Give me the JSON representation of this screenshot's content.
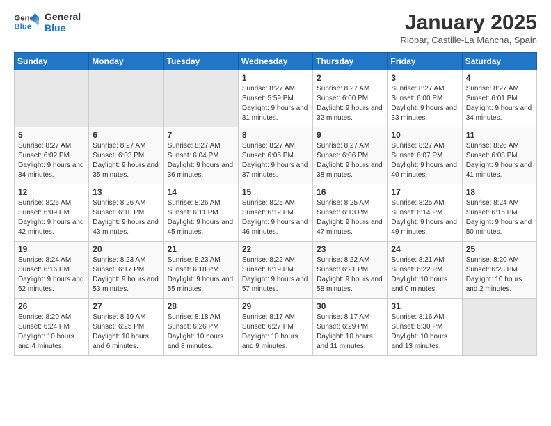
{
  "logo": {
    "line1": "General",
    "line2": "Blue"
  },
  "header": {
    "title": "January 2025",
    "location": "Riopar, Castille-La Mancha, Spain"
  },
  "weekdays": [
    "Sunday",
    "Monday",
    "Tuesday",
    "Wednesday",
    "Thursday",
    "Friday",
    "Saturday"
  ],
  "weeks": [
    [
      {
        "day": "",
        "empty": true
      },
      {
        "day": "",
        "empty": true
      },
      {
        "day": "",
        "empty": true
      },
      {
        "day": "1",
        "sunrise": "8:27 AM",
        "sunset": "5:59 PM",
        "daylight": "9 hours and 31 minutes."
      },
      {
        "day": "2",
        "sunrise": "8:27 AM",
        "sunset": "6:00 PM",
        "daylight": "9 hours and 32 minutes."
      },
      {
        "day": "3",
        "sunrise": "8:27 AM",
        "sunset": "6:00 PM",
        "daylight": "9 hours and 33 minutes."
      },
      {
        "day": "4",
        "sunrise": "8:27 AM",
        "sunset": "6:01 PM",
        "daylight": "9 hours and 34 minutes."
      }
    ],
    [
      {
        "day": "5",
        "sunrise": "8:27 AM",
        "sunset": "6:02 PM",
        "daylight": "9 hours and 34 minutes."
      },
      {
        "day": "6",
        "sunrise": "8:27 AM",
        "sunset": "6:03 PM",
        "daylight": "9 hours and 35 minutes."
      },
      {
        "day": "7",
        "sunrise": "8:27 AM",
        "sunset": "6:04 PM",
        "daylight": "9 hours and 36 minutes."
      },
      {
        "day": "8",
        "sunrise": "8:27 AM",
        "sunset": "6:05 PM",
        "daylight": "9 hours and 37 minutes."
      },
      {
        "day": "9",
        "sunrise": "8:27 AM",
        "sunset": "6:06 PM",
        "daylight": "9 hours and 38 minutes."
      },
      {
        "day": "10",
        "sunrise": "8:27 AM",
        "sunset": "6:07 PM",
        "daylight": "9 hours and 40 minutes."
      },
      {
        "day": "11",
        "sunrise": "8:26 AM",
        "sunset": "6:08 PM",
        "daylight": "9 hours and 41 minutes."
      }
    ],
    [
      {
        "day": "12",
        "sunrise": "8:26 AM",
        "sunset": "6:09 PM",
        "daylight": "9 hours and 42 minutes."
      },
      {
        "day": "13",
        "sunrise": "8:26 AM",
        "sunset": "6:10 PM",
        "daylight": "9 hours and 43 minutes."
      },
      {
        "day": "14",
        "sunrise": "8:26 AM",
        "sunset": "6:11 PM",
        "daylight": "9 hours and 45 minutes."
      },
      {
        "day": "15",
        "sunrise": "8:25 AM",
        "sunset": "6:12 PM",
        "daylight": "9 hours and 46 minutes."
      },
      {
        "day": "16",
        "sunrise": "8:25 AM",
        "sunset": "6:13 PM",
        "daylight": "9 hours and 47 minutes."
      },
      {
        "day": "17",
        "sunrise": "8:25 AM",
        "sunset": "6:14 PM",
        "daylight": "9 hours and 49 minutes."
      },
      {
        "day": "18",
        "sunrise": "8:24 AM",
        "sunset": "6:15 PM",
        "daylight": "9 hours and 50 minutes."
      }
    ],
    [
      {
        "day": "19",
        "sunrise": "8:24 AM",
        "sunset": "6:16 PM",
        "daylight": "9 hours and 52 minutes."
      },
      {
        "day": "20",
        "sunrise": "8:23 AM",
        "sunset": "6:17 PM",
        "daylight": "9 hours and 53 minutes."
      },
      {
        "day": "21",
        "sunrise": "8:23 AM",
        "sunset": "6:18 PM",
        "daylight": "9 hours and 55 minutes."
      },
      {
        "day": "22",
        "sunrise": "8:22 AM",
        "sunset": "6:19 PM",
        "daylight": "9 hours and 57 minutes."
      },
      {
        "day": "23",
        "sunrise": "8:22 AM",
        "sunset": "6:21 PM",
        "daylight": "9 hours and 58 minutes."
      },
      {
        "day": "24",
        "sunrise": "8:21 AM",
        "sunset": "6:22 PM",
        "daylight": "10 hours and 0 minutes."
      },
      {
        "day": "25",
        "sunrise": "8:20 AM",
        "sunset": "6:23 PM",
        "daylight": "10 hours and 2 minutes."
      }
    ],
    [
      {
        "day": "26",
        "sunrise": "8:20 AM",
        "sunset": "6:24 PM",
        "daylight": "10 hours and 4 minutes."
      },
      {
        "day": "27",
        "sunrise": "8:19 AM",
        "sunset": "6:25 PM",
        "daylight": "10 hours and 6 minutes."
      },
      {
        "day": "28",
        "sunrise": "8:18 AM",
        "sunset": "6:26 PM",
        "daylight": "10 hours and 8 minutes."
      },
      {
        "day": "29",
        "sunrise": "8:17 AM",
        "sunset": "6:27 PM",
        "daylight": "10 hours and 9 minutes."
      },
      {
        "day": "30",
        "sunrise": "8:17 AM",
        "sunset": "6:29 PM",
        "daylight": "10 hours and 11 minutes."
      },
      {
        "day": "31",
        "sunrise": "8:16 AM",
        "sunset": "6:30 PM",
        "daylight": "10 hours and 13 minutes."
      },
      {
        "day": "",
        "empty": true
      }
    ]
  ]
}
